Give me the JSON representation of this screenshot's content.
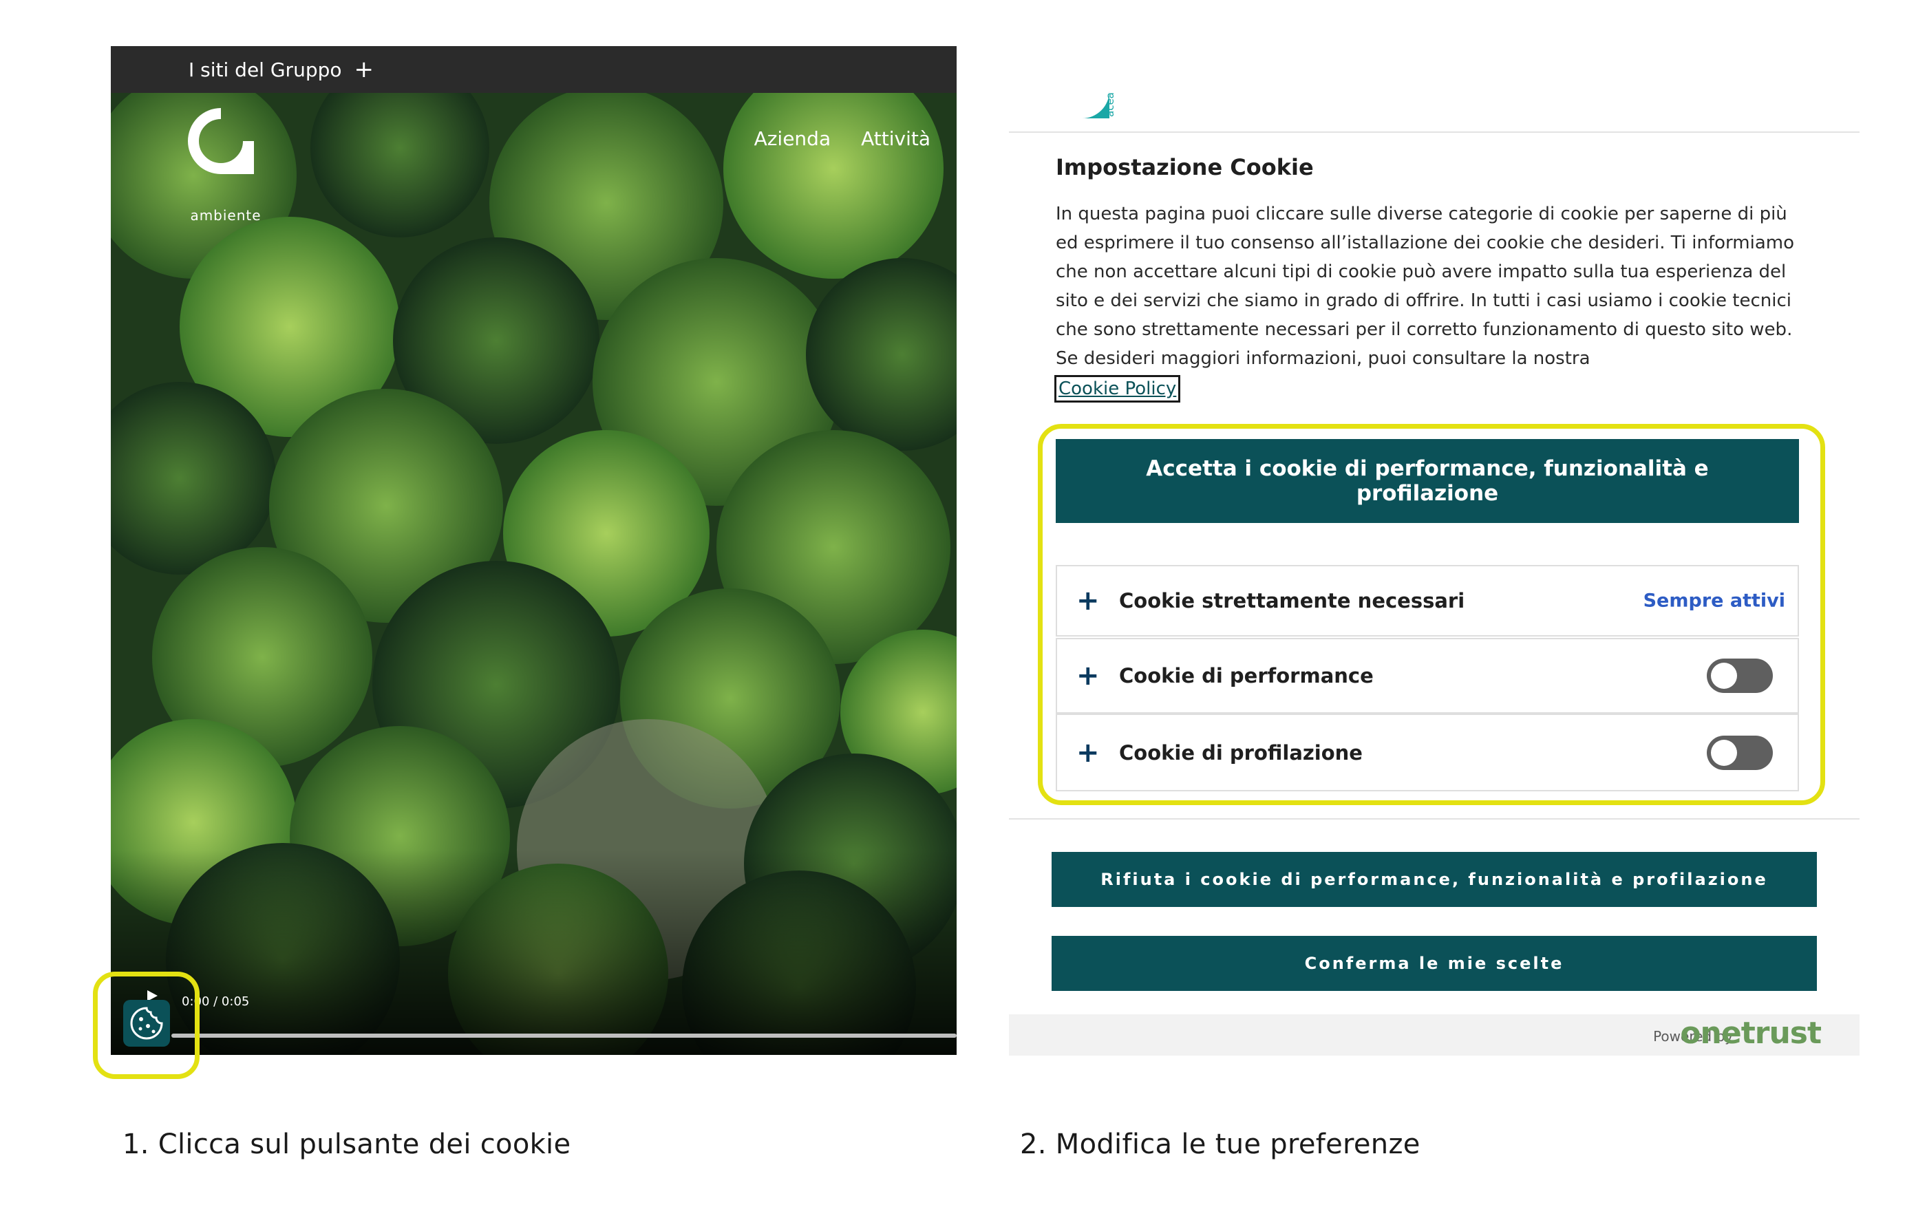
{
  "site": {
    "group_menu_label": "I siti del Gruppo",
    "logo_brand": "acea",
    "logo_subtitle": "ambiente",
    "nav": [
      "Azienda",
      "Attività"
    ],
    "player_time": "0:00 / 0:05"
  },
  "captions": {
    "step1": "1. Clicca sul pulsante dei cookie",
    "step2": "2. Modifica le tue preferenze"
  },
  "cookie_panel": {
    "logo_text": "acea",
    "title": "Impostazione Cookie",
    "description": "In questa pagina puoi cliccare sulle diverse categorie di cookie per saperne di più ed esprimere il tuo consenso all’istallazione dei cookie che desideri. Ti informiamo che non accettare alcuni tipi di cookie può avere impatto sulla tua esperienza del sito e dei servizi che siamo in grado di offrire. In tutti i casi usiamo i cookie tecnici che sono strettamente necessari per il corretto funzionamento di questo sito web. Se desideri maggiori informazioni, puoi consultare la nostra",
    "policy_link": "Cookie Policy",
    "accept_button": "Accetta i cookie di performance, funzionalità e profilazione",
    "categories": [
      {
        "name": "Cookie strettamente necessari",
        "status": "Sempre attivi"
      },
      {
        "name": "Cookie di performance",
        "enabled": false
      },
      {
        "name": "Cookie di profilazione",
        "enabled": false
      }
    ],
    "reject_button": "Rifiuta i cookie di performance, funzionalità e profilazione",
    "confirm_button": "Conferma le mie scelte",
    "powered_by": "Powered by",
    "powered_brand": "onetrust"
  },
  "colors": {
    "brand_teal": "#0b5158",
    "highlight_yellow": "#e3e112",
    "link_blue": "#2d5cc4",
    "onetrust_green": "#6a9a5a"
  },
  "icons": [
    "plus-icon",
    "play-icon",
    "cookie-icon",
    "acea-logo",
    "toggle-switch"
  ]
}
